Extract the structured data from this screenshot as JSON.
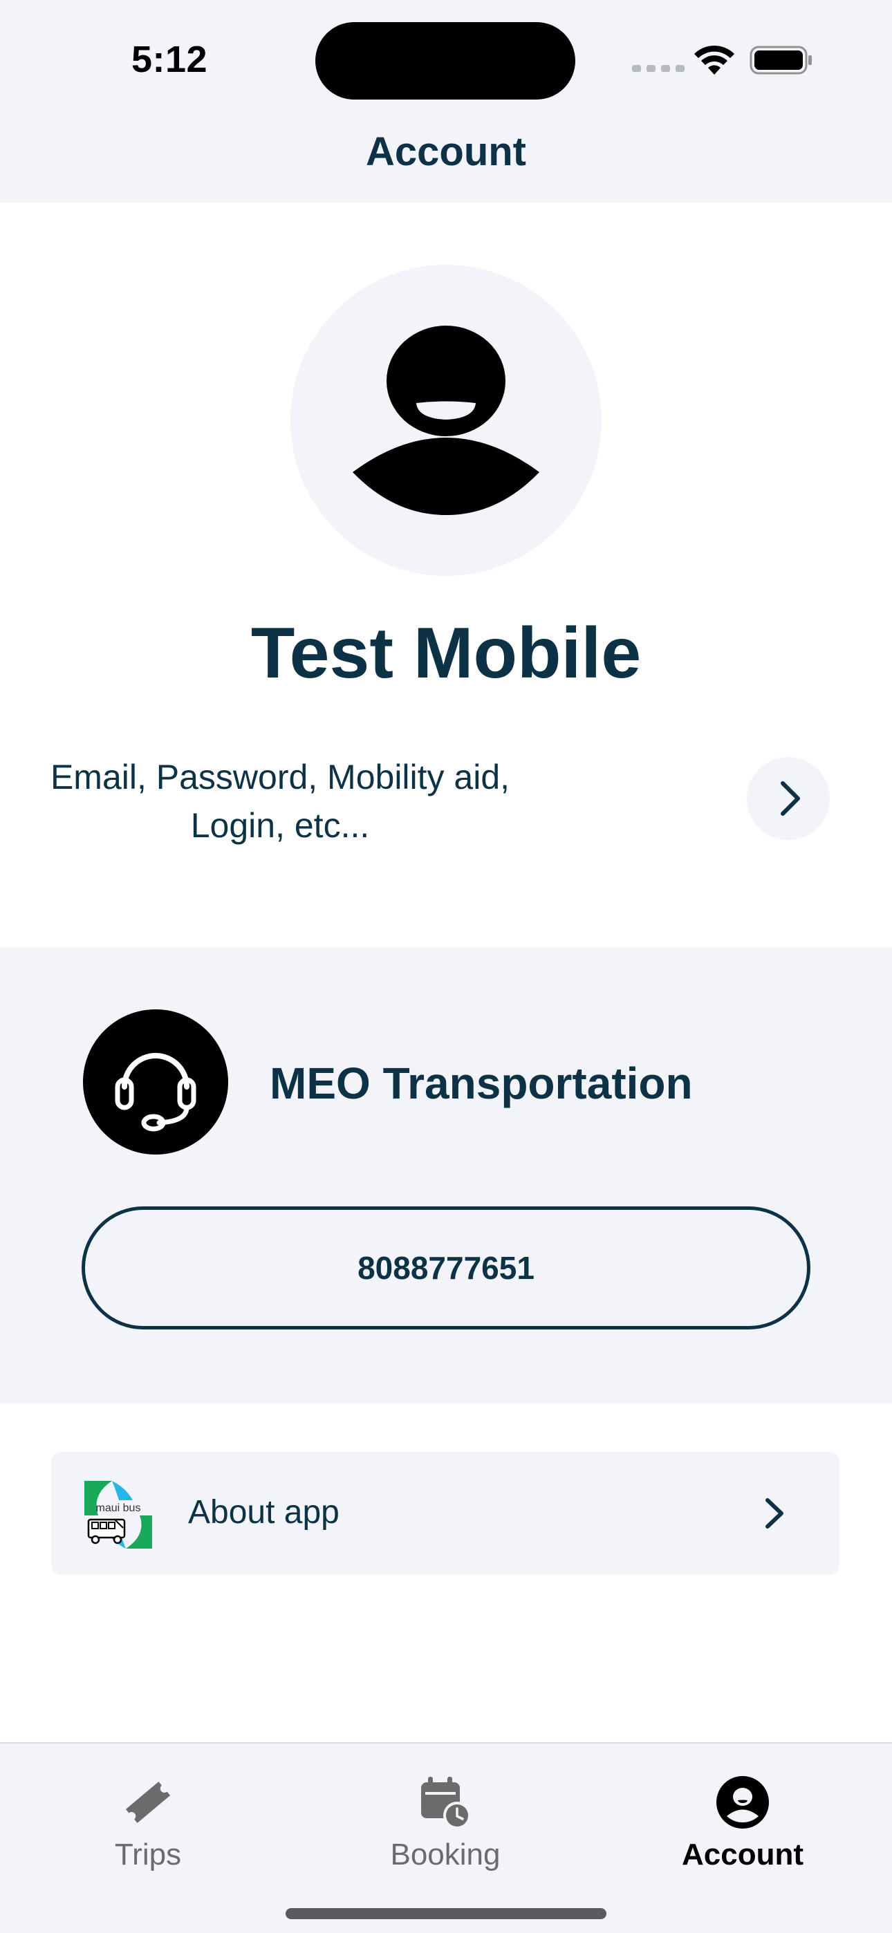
{
  "status_bar": {
    "time": "5:12"
  },
  "header": {
    "title": "Account"
  },
  "profile": {
    "name": "Test Mobile",
    "settings_description": "Email, Password, Mobility aid, Login, etc..."
  },
  "support": {
    "provider_name": "MEO Transportation",
    "phone": "8088777651"
  },
  "about": {
    "label": "About app",
    "logo_text": "maui bus"
  },
  "tab_bar": {
    "tabs": [
      {
        "label": "Trips",
        "icon": "ticket-icon",
        "active": false
      },
      {
        "label": "Booking",
        "icon": "calendar-clock-icon",
        "active": false
      },
      {
        "label": "Account",
        "icon": "person-circle-icon",
        "active": true
      }
    ]
  },
  "colors": {
    "primary": "#0e3245",
    "background": "#f3f4f9",
    "surface": "#ffffff",
    "inactive_tab": "#6b6b6b"
  }
}
